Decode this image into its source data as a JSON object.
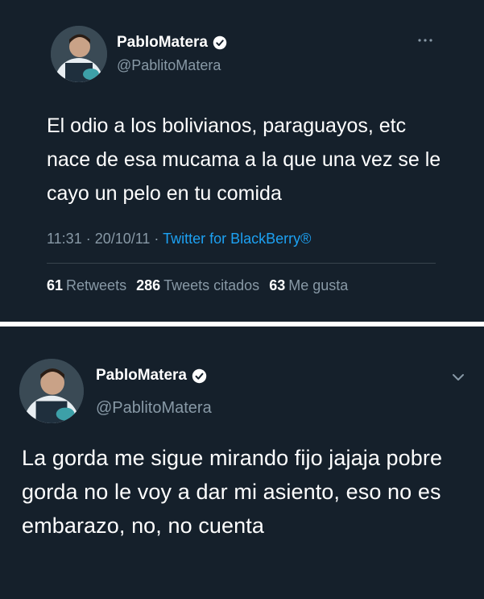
{
  "colors": {
    "background": "#15202b",
    "text": "#ffffff",
    "secondary": "#8899a6",
    "accent": "#1da1f2",
    "divider": "#38444d"
  },
  "tweet1": {
    "display_name": "PabloMatera",
    "handle": "@PablitoMatera",
    "verified": true,
    "text": "El odio a los bolivianos, paraguayos, etc nace de esa mucama a la que una vez se le cayo un pelo en tu comida",
    "time": "11:31 · 20/10/11 · ",
    "source": "Twitter for BlackBerry®",
    "stats": {
      "retweets_count": "61",
      "retweets_label": "Retweets",
      "quotes_count": "286",
      "quotes_label": "Tweets citados",
      "likes_count": "63",
      "likes_label": "Me gusta"
    },
    "more_icon": "more-icon"
  },
  "tweet2": {
    "display_name": "PabloMatera",
    "handle": "@PablitoMatera",
    "verified": true,
    "text": "La gorda me sigue mirando fijo jajaja pobre gorda no le voy a dar mi asiento, eso no es embarazo, no, no cuenta",
    "menu_icon": "chevron-down-icon"
  }
}
